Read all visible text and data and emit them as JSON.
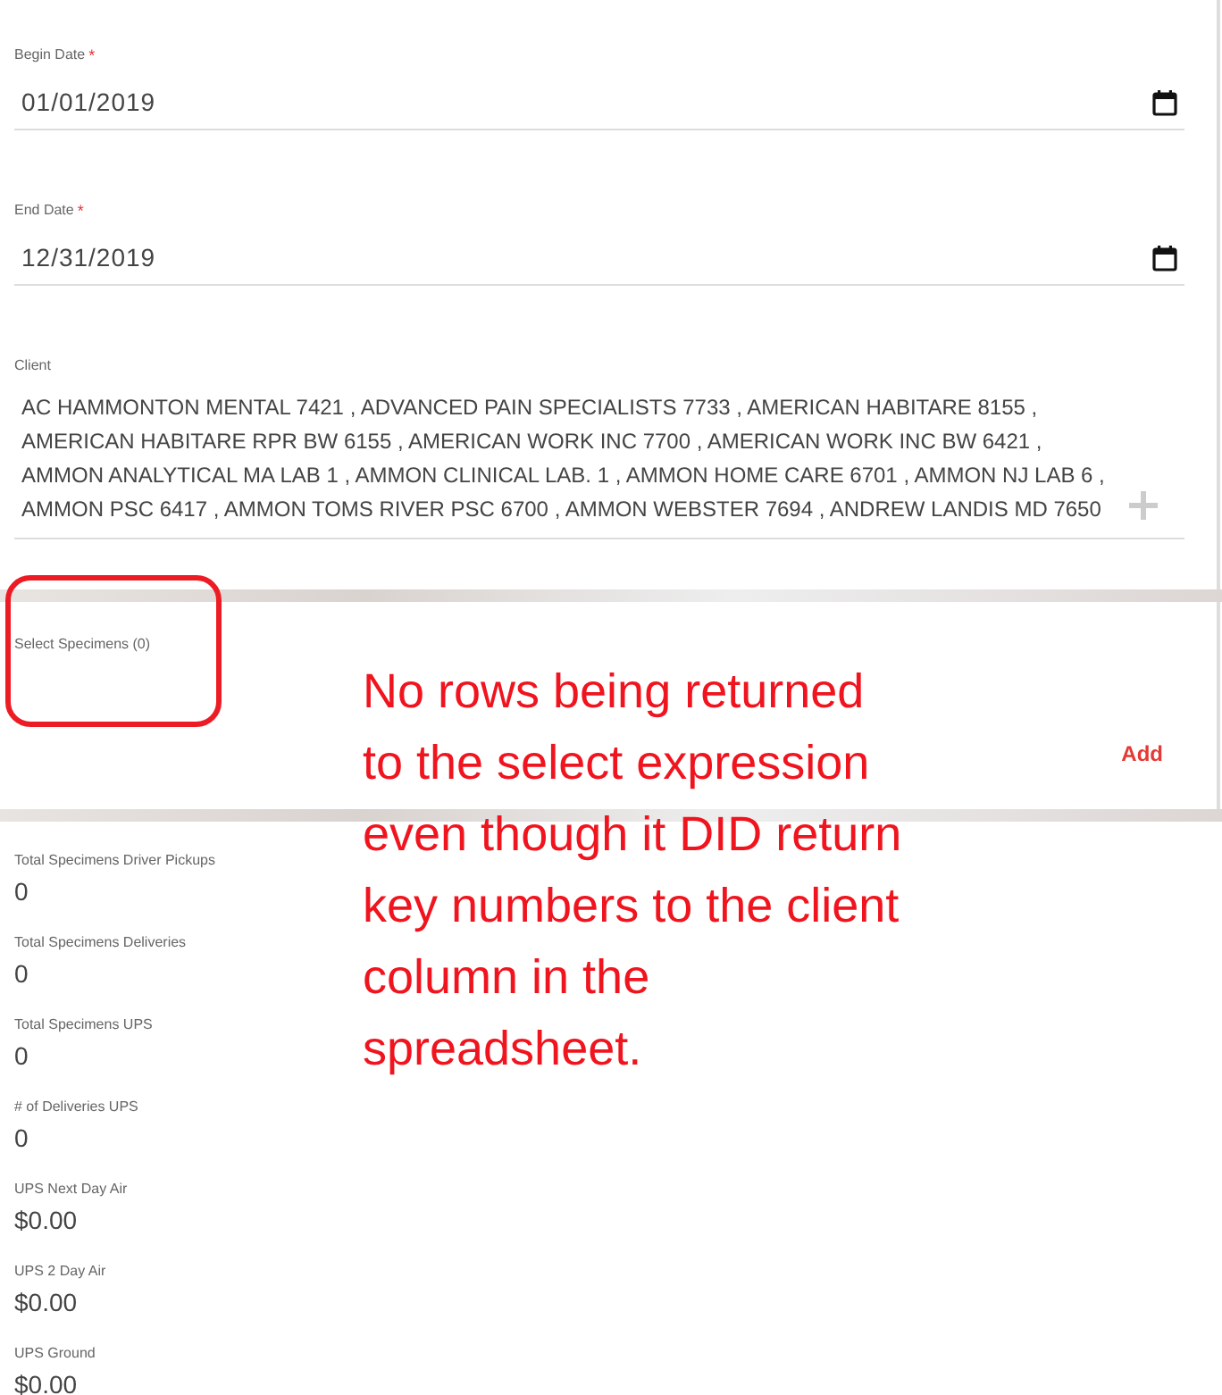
{
  "fields": [
    {
      "kind": "date",
      "label": "Begin Date",
      "required_mark": "*",
      "value": "01/01/2019"
    },
    {
      "kind": "date",
      "label": "End Date",
      "required_mark": "*",
      "value": "12/31/2019"
    },
    {
      "kind": "multiselect",
      "label": "Client",
      "value": "AC HAMMONTON MENTAL 7421 , ADVANCED PAIN SPECIALISTS 7733 , AMERICAN HABITARE 8155 , AMERICAN HABITARE RPR BW 6155 , AMERICAN WORK INC 7700 , AMERICAN WORK INC BW 6421 , AMMON ANALYTICAL MA LAB 1 , AMMON CLINICAL LAB. 1 , AMMON HOME CARE 6701 , AMMON NJ LAB 6 , AMMON PSC 6417 , AMMON TOMS RIVER PSC 6700 , AMMON WEBSTER 7694 , ANDREW LANDIS MD 7650"
    }
  ],
  "specimens": {
    "label": "Select Specimens (0)",
    "add_button": "Add"
  },
  "totals": [
    {
      "label": "Total Specimens Driver Pickups",
      "value": "0"
    },
    {
      "label": "Total Specimens Deliveries",
      "value": "0"
    },
    {
      "label": "Total Specimens UPS",
      "value": "0"
    },
    {
      "label": "# of Deliveries UPS",
      "value": "0"
    },
    {
      "label": "UPS Next Day Air",
      "value": "$0.00"
    },
    {
      "label": "UPS 2 Day Air",
      "value": "$0.00"
    },
    {
      "label": "UPS Ground",
      "value": "$0.00"
    }
  ],
  "annotation": {
    "text": "No rows being returned\nto the select expression\neven though it DID return\nkey numbers to the client\ncolumn in the\nspreadsheet.",
    "highlight": true
  }
}
